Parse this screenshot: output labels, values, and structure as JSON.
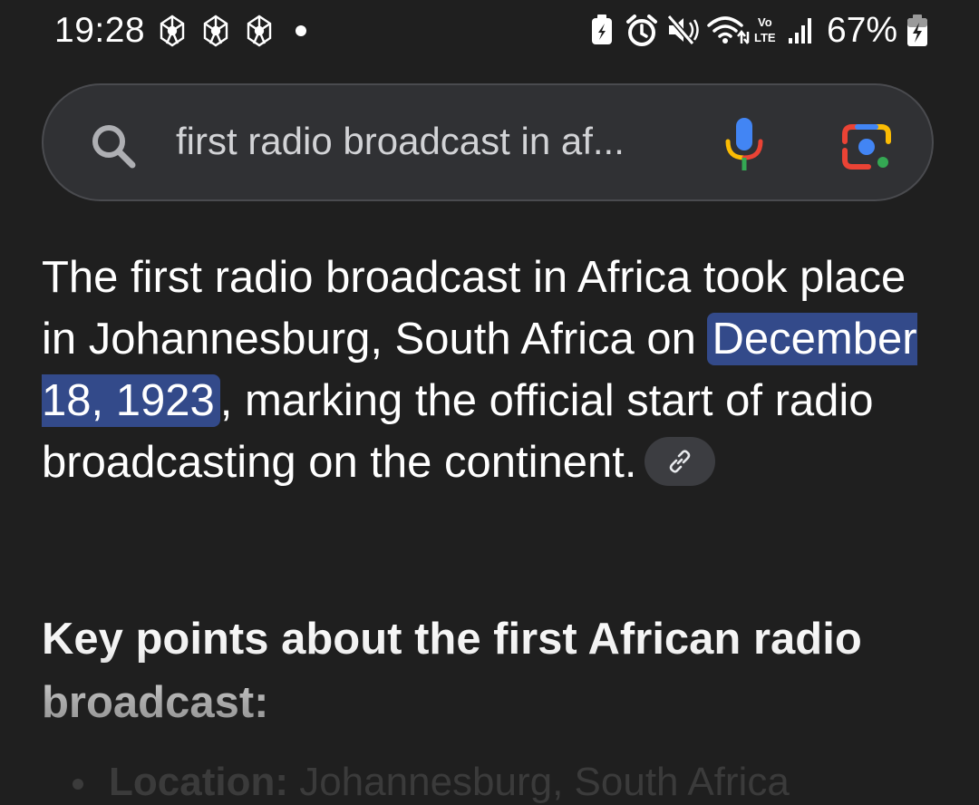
{
  "status_bar": {
    "time": "19:28",
    "battery_percent": "67%",
    "network_label_top": "Vo",
    "network_label_bottom": "LTE",
    "notification_icons": [
      "pinwheel-app-icon",
      "pinwheel-app-icon",
      "pinwheel-app-icon"
    ],
    "system_icons": [
      "battery-saver-icon",
      "alarm-icon",
      "mute-icon",
      "wifi-icon",
      "volte-icon",
      "signal-icon",
      "battery-icon"
    ]
  },
  "search": {
    "query": "first radio broadcast in af...",
    "icons": [
      "search-icon",
      "mic-icon",
      "lens-icon"
    ],
    "colors": {
      "blue": "#4285f4",
      "red": "#ea4335",
      "yellow": "#fbbc04",
      "green": "#34a853"
    }
  },
  "answer": {
    "before_highlight": "The first radio broadcast in Africa took place in Johannesburg, South Africa on ",
    "highlight": "December 18, 1923",
    "after_highlight": ", marking the official start of radio broadcasting on the continent.",
    "highlight_color": "#334a8a",
    "link_icon": "link-icon"
  },
  "key_points": {
    "heading": "Key points about the first African radio broadcast:",
    "first_bullet_label": "Location:",
    "first_bullet_value": " Johannesburg, South Africa"
  }
}
